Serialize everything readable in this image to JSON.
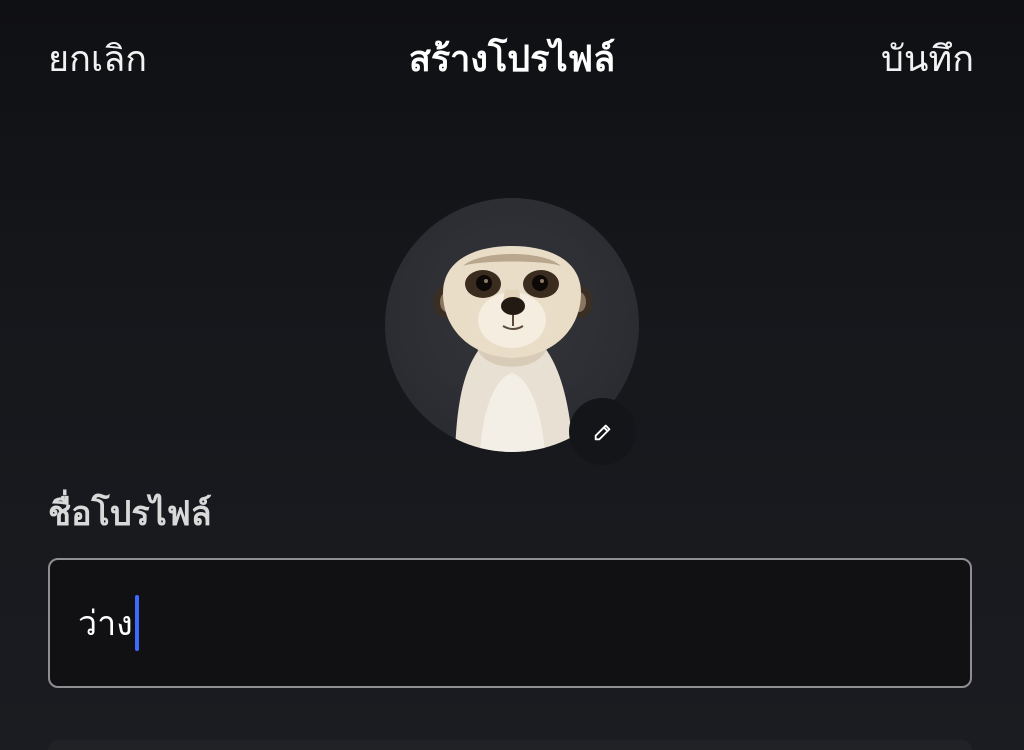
{
  "header": {
    "cancel_label": "ยกเลิก",
    "title": "สร้างโปรไฟล์",
    "save_label": "บันทึก"
  },
  "avatar": {
    "image": "meerkat-avatar",
    "edit_icon": "pencil-icon"
  },
  "profile_name": {
    "label": "ชื่อโปรไฟล์",
    "value": "ว่าง"
  },
  "colors": {
    "background": "#15171b",
    "caret": "#3b6cff",
    "input_border": "#8e8e93",
    "input_bg": "#111113"
  }
}
